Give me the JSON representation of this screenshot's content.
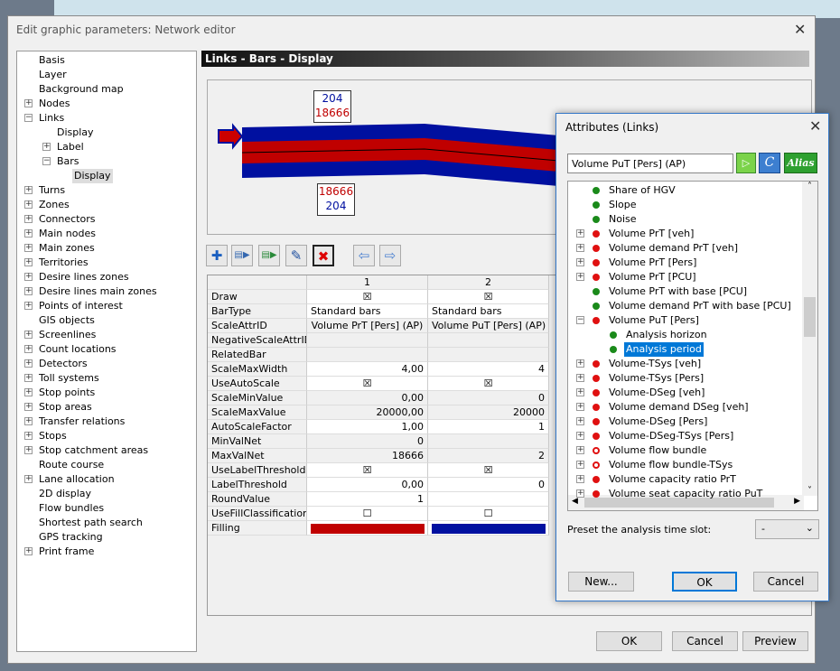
{
  "main_dialog": {
    "title": "Edit graphic parameters: Network editor",
    "header": "Links - Bars - Display",
    "tree": [
      {
        "label": "Basis",
        "level": 0,
        "exp": ""
      },
      {
        "label": "Layer",
        "level": 0,
        "exp": ""
      },
      {
        "label": "Background map",
        "level": 0,
        "exp": ""
      },
      {
        "label": "Nodes",
        "level": 0,
        "exp": "+"
      },
      {
        "label": "Links",
        "level": 0,
        "exp": "-"
      },
      {
        "label": "Display",
        "level": 1,
        "exp": ""
      },
      {
        "label": "Label",
        "level": 1,
        "exp": "+"
      },
      {
        "label": "Bars",
        "level": 1,
        "exp": "-"
      },
      {
        "label": "Display",
        "level": 2,
        "exp": "",
        "selected": true
      },
      {
        "label": "Turns",
        "level": 0,
        "exp": "+"
      },
      {
        "label": "Zones",
        "level": 0,
        "exp": "+"
      },
      {
        "label": "Connectors",
        "level": 0,
        "exp": "+"
      },
      {
        "label": "Main nodes",
        "level": 0,
        "exp": "+"
      },
      {
        "label": "Main zones",
        "level": 0,
        "exp": "+"
      },
      {
        "label": "Territories",
        "level": 0,
        "exp": "+"
      },
      {
        "label": "Desire lines zones",
        "level": 0,
        "exp": "+"
      },
      {
        "label": "Desire lines main zones",
        "level": 0,
        "exp": "+"
      },
      {
        "label": "Points of interest",
        "level": 0,
        "exp": "+"
      },
      {
        "label": "GIS objects",
        "level": 0,
        "exp": ""
      },
      {
        "label": "Screenlines",
        "level": 0,
        "exp": "+"
      },
      {
        "label": "Count locations",
        "level": 0,
        "exp": "+"
      },
      {
        "label": "Detectors",
        "level": 0,
        "exp": "+"
      },
      {
        "label": "Toll systems",
        "level": 0,
        "exp": "+"
      },
      {
        "label": "Stop points",
        "level": 0,
        "exp": "+"
      },
      {
        "label": "Stop areas",
        "level": 0,
        "exp": "+"
      },
      {
        "label": "Transfer relations",
        "level": 0,
        "exp": "+"
      },
      {
        "label": "Stops",
        "level": 0,
        "exp": "+"
      },
      {
        "label": "Stop catchment areas",
        "level": 0,
        "exp": "+"
      },
      {
        "label": "Route course",
        "level": 0,
        "exp": ""
      },
      {
        "label": "Lane allocation",
        "level": 0,
        "exp": "+"
      },
      {
        "label": "2D display",
        "level": 0,
        "exp": ""
      },
      {
        "label": "Flow bundles",
        "level": 0,
        "exp": ""
      },
      {
        "label": "Shortest path search",
        "level": 0,
        "exp": ""
      },
      {
        "label": "GPS tracking",
        "level": 0,
        "exp": ""
      },
      {
        "label": "Print frame",
        "level": 0,
        "exp": "+"
      }
    ],
    "preview": {
      "top_label": [
        "204",
        "18666"
      ],
      "bottom_label": [
        "18666",
        "204"
      ],
      "bar_colors": {
        "outer": "#0010a0",
        "inner": "#c00000"
      }
    },
    "toolbar": [
      "add-icon",
      "copy-left-icon",
      "copy-right-icon",
      "edit-icon",
      "delete-icon",
      "arrow-left-icon",
      "arrow-right-icon"
    ],
    "grid": {
      "columns": [
        "1",
        "2"
      ],
      "rows": [
        {
          "name": "Draw",
          "v": [
            "☒",
            "☒"
          ],
          "type": "check"
        },
        {
          "name": "BarType",
          "v": [
            "Standard bars",
            "Standard bars"
          ],
          "type": "left"
        },
        {
          "name": "ScaleAttrID",
          "v": [
            "Volume PrT [Pers] (AP)",
            "Volume PuT [Pers] (AP)"
          ],
          "type": "center"
        },
        {
          "name": "NegativeScaleAttrID",
          "v": [
            "",
            ""
          ],
          "type": "grey"
        },
        {
          "name": "RelatedBar",
          "v": [
            "",
            ""
          ],
          "type": "grey"
        },
        {
          "name": "ScaleMaxWidth",
          "v": [
            "4,00",
            "4"
          ],
          "type": "right"
        },
        {
          "name": "UseAutoScale",
          "v": [
            "☒",
            "☒"
          ],
          "type": "check"
        },
        {
          "name": "ScaleMinValue",
          "v": [
            "0,00",
            "0"
          ],
          "type": "rightgrey"
        },
        {
          "name": "ScaleMaxValue",
          "v": [
            "20000,00",
            "20000"
          ],
          "type": "rightgrey"
        },
        {
          "name": "AutoScaleFactor",
          "v": [
            "1,00",
            "1"
          ],
          "type": "right"
        },
        {
          "name": "MinValNet",
          "v": [
            "0",
            ""
          ],
          "type": "rightgrey"
        },
        {
          "name": "MaxValNet",
          "v": [
            "18666",
            "2"
          ],
          "type": "rightgrey"
        },
        {
          "name": "UseLabelThreshold",
          "v": [
            "☒",
            "☒"
          ],
          "type": "check"
        },
        {
          "name": "LabelThreshold",
          "v": [
            "0,00",
            "0"
          ],
          "type": "right"
        },
        {
          "name": "RoundValue",
          "v": [
            "1",
            ""
          ],
          "type": "right"
        },
        {
          "name": "UseFillClassification",
          "v": [
            "☐",
            "☐"
          ],
          "type": "check"
        },
        {
          "name": "Filling",
          "v": [
            "#c00000",
            "#0010a0"
          ],
          "type": "color"
        }
      ]
    },
    "buttons": {
      "ok": "OK",
      "cancel": "Cancel",
      "preview": "Preview"
    }
  },
  "attributes_dialog": {
    "title": "Attributes (Links)",
    "input": "Volume PuT [Pers] (AP)",
    "btn_c": "C",
    "btn_alias": "Alias",
    "items": [
      {
        "label": "Share of HGV",
        "color": "green",
        "level": 0,
        "exp": ""
      },
      {
        "label": "Slope",
        "color": "green",
        "level": 0,
        "exp": ""
      },
      {
        "label": "Noise",
        "color": "green",
        "level": 0,
        "exp": ""
      },
      {
        "label": "Volume PrT [veh]",
        "color": "red",
        "level": 0,
        "exp": "+"
      },
      {
        "label": "Volume demand  PrT [veh]",
        "color": "red",
        "level": 0,
        "exp": "+"
      },
      {
        "label": "Volume PrT [Pers]",
        "color": "red",
        "level": 0,
        "exp": "+"
      },
      {
        "label": "Volume PrT [PCU]",
        "color": "red",
        "level": 0,
        "exp": "+"
      },
      {
        "label": "Volume PrT with base [PCU]",
        "color": "green",
        "level": 0,
        "exp": ""
      },
      {
        "label": "Volume demand PrT with base [PCU]",
        "color": "green",
        "level": 0,
        "exp": ""
      },
      {
        "label": "Volume PuT [Pers]",
        "color": "red",
        "level": 0,
        "exp": "-"
      },
      {
        "label": "Analysis horizon",
        "color": "green",
        "level": 1,
        "exp": ""
      },
      {
        "label": "Analysis period",
        "color": "green",
        "level": 1,
        "exp": "",
        "selected": true
      },
      {
        "label": "Volume-TSys [veh]",
        "color": "red",
        "level": 0,
        "exp": "+"
      },
      {
        "label": "Volume-TSys [Pers]",
        "color": "red",
        "level": 0,
        "exp": "+"
      },
      {
        "label": "Volume-DSeg [veh]",
        "color": "red",
        "level": 0,
        "exp": "+"
      },
      {
        "label": "Volume demand DSeg [veh]",
        "color": "red",
        "level": 0,
        "exp": "+"
      },
      {
        "label": "Volume-DSeg [Pers]",
        "color": "red",
        "level": 0,
        "exp": "+"
      },
      {
        "label": "Volume-DSeg-TSys [Pers]",
        "color": "red",
        "level": 0,
        "exp": "+"
      },
      {
        "label": "Volume flow bundle",
        "color": "redring",
        "level": 0,
        "exp": "+"
      },
      {
        "label": "Volume flow bundle-TSys",
        "color": "redring",
        "level": 0,
        "exp": "+"
      },
      {
        "label": "Volume capacity ratio PrT",
        "color": "red",
        "level": 0,
        "exp": "+"
      },
      {
        "label": "Volume seat capacity ratio PuT",
        "color": "red",
        "level": 0,
        "exp": "+"
      }
    ],
    "preset_label": "Preset the analysis time slot:",
    "preset_value": "-",
    "buttons": {
      "new": "New...",
      "ok": "OK",
      "cancel": "Cancel"
    }
  }
}
